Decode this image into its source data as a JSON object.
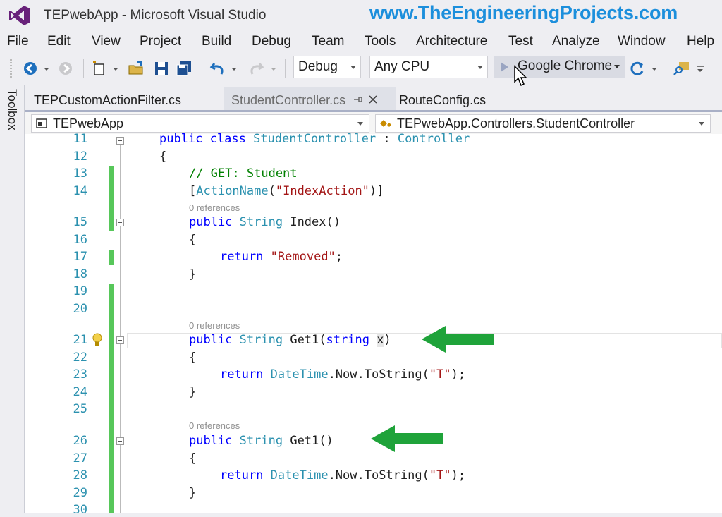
{
  "window": {
    "title": "TEPwebApp - Microsoft Visual Studio",
    "watermark": "www.TheEngineeringProjects.com"
  },
  "menu": [
    "File",
    "Edit",
    "View",
    "Project",
    "Build",
    "Debug",
    "Team",
    "Tools",
    "Architecture",
    "Test",
    "Analyze",
    "Window",
    "Help"
  ],
  "toolbar": {
    "configuration": "Debug",
    "platform": "Any CPU",
    "start_target": "Google Chrome"
  },
  "toolbox_label": "Toolbox",
  "tabs": [
    {
      "label": "TEPCustomActionFilter.cs"
    },
    {
      "label": "StudentController.cs"
    },
    {
      "label": "RouteConfig.cs"
    }
  ],
  "navbar": {
    "project": "TEPwebApp",
    "type": "TEPwebApp.Controllers.StudentController"
  },
  "codelens_text": "0 references",
  "code": {
    "l11": {
      "num": "11",
      "kw1": "public",
      "kw2": "class",
      "name": "StudentController",
      "sep": " : ",
      "base": "Controller"
    },
    "l12": {
      "num": "12",
      "text": "{"
    },
    "l13": {
      "num": "13",
      "comment": "// GET: Student"
    },
    "l14": {
      "num": "14",
      "open": "[",
      "attr": "ActionName",
      "p1": "(",
      "str": "\"IndexAction\"",
      "p2": ")]"
    },
    "l15": {
      "num": "15",
      "kw": "public",
      "type": "String",
      "rest": " Index()"
    },
    "l16": {
      "num": "16",
      "text": "{"
    },
    "l17": {
      "num": "17",
      "kw": "return",
      "str": "\"Removed\"",
      "end": ";"
    },
    "l18": {
      "num": "18",
      "text": "}"
    },
    "l19": {
      "num": "19"
    },
    "l20": {
      "num": "20"
    },
    "l21": {
      "num": "21",
      "kw": "public",
      "type": "String",
      "mid": " Get1(",
      "kw2": "string",
      "sp": " ",
      "param": "x",
      "end": ")"
    },
    "l22": {
      "num": "22",
      "text": "{"
    },
    "l23": {
      "num": "23",
      "kw": "return",
      "type": "DateTime",
      "mid": ".Now.ToString(",
      "str": "\"T\"",
      "end": ");"
    },
    "l24": {
      "num": "24",
      "text": "}"
    },
    "l25": {
      "num": "25"
    },
    "l26": {
      "num": "26",
      "kw": "public",
      "type": "String",
      "rest": " Get1()"
    },
    "l27": {
      "num": "27",
      "text": "{"
    },
    "l28": {
      "num": "28",
      "kw": "return",
      "type": "DateTime",
      "mid": ".Now.ToString(",
      "str": "\"T\"",
      "end": ");"
    },
    "l29": {
      "num": "29",
      "text": "}"
    },
    "l30": {
      "num": "30"
    }
  },
  "colors": {
    "accent": "#68217a",
    "watermark": "#1c8fdc",
    "change_bar": "#57c75a",
    "annotation_arrow": "#1fa33a"
  }
}
